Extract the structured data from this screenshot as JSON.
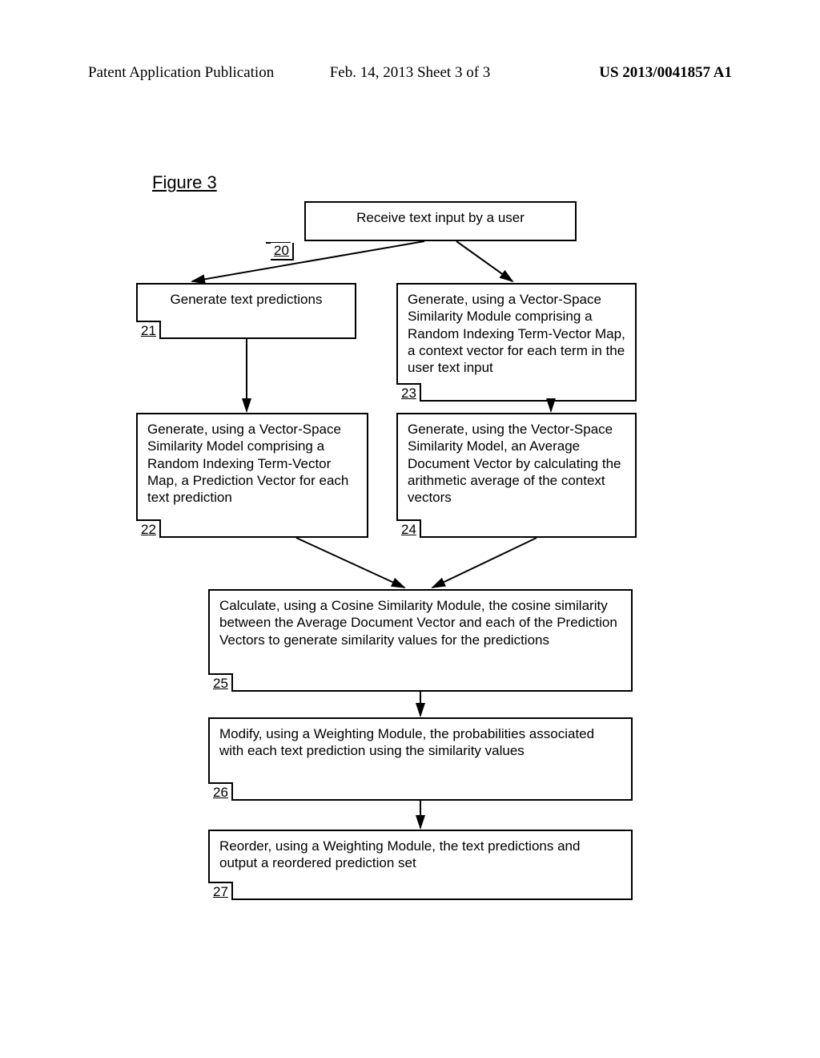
{
  "header": {
    "left": "Patent Application Publication",
    "center": "Feb. 14, 2013  Sheet 3 of 3",
    "right": "US 2013/0041857 A1"
  },
  "figure_title": "Figure 3",
  "boxes": {
    "b20": {
      "num": "20",
      "text": "Receive text input by a user"
    },
    "b21": {
      "num": "21",
      "text": "Generate text predictions"
    },
    "b22": {
      "num": "22",
      "text": "Generate, using a Vector-Space Similarity Model comprising a Random Indexing Term-Vector Map, a Prediction Vector for each text prediction"
    },
    "b23": {
      "num": "23",
      "text": "Generate, using a Vector-Space Similarity Module comprising a Random Indexing Term-Vector Map, a context vector for each term in the user text input"
    },
    "b24": {
      "num": "24",
      "text": "Generate, using the Vector-Space Similarity Model, an Average Document Vector by calculating the arithmetic average of the context vectors"
    },
    "b25": {
      "num": "25",
      "text": "Calculate, using a Cosine Similarity Module, the cosine similarity between the Average Document Vector and each of the Prediction Vectors to generate similarity values for the predictions"
    },
    "b26": {
      "num": "26",
      "text": "Modify, using a Weighting Module, the probabilities associated with each text prediction using the similarity values"
    },
    "b27": {
      "num": "27",
      "text": "Reorder, using a Weighting Module, the text predictions and output a reordered prediction set"
    }
  }
}
